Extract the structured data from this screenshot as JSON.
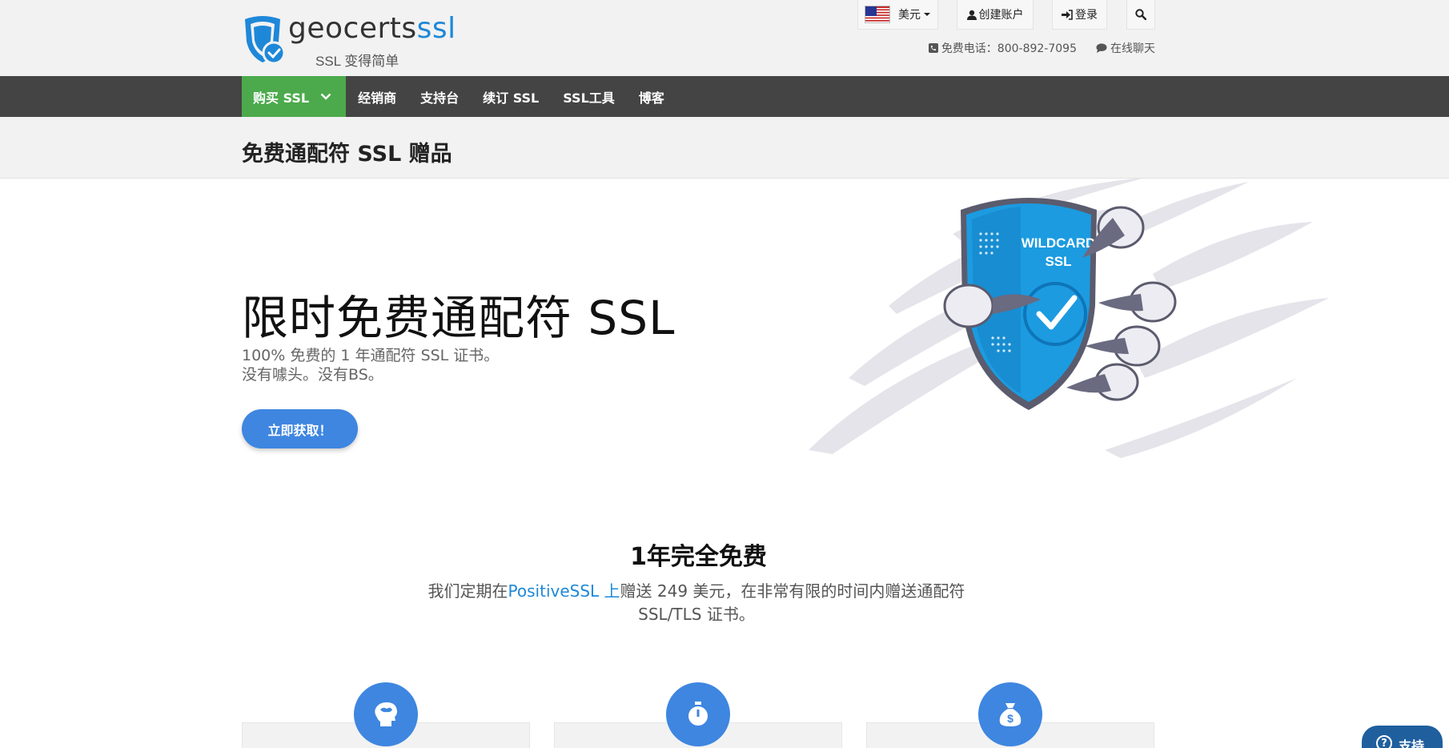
{
  "brand": {
    "name_main": "geocerts",
    "name_accent": "ssl",
    "tagline": "SSL 变得简单"
  },
  "utility": {
    "currency_label": "美元",
    "create_account_label": "创建账户",
    "login_label": "登录",
    "phone_text": "免费电话：800-892-7095",
    "chat_text": "在线聊天"
  },
  "nav": {
    "items": [
      {
        "label": "购买 SSL",
        "active": true
      },
      {
        "label": "经销商"
      },
      {
        "label": "支持台"
      },
      {
        "label": "续订 SSL"
      },
      {
        "label": "SSL工具"
      },
      {
        "label": "博客"
      }
    ]
  },
  "page": {
    "title": "免费通配符 SSL 赠品"
  },
  "hero": {
    "heading": "限时免费通配符 SSL",
    "sub_line1": "100% 免费的 1 年通配符 SSL 证书。",
    "sub_line2": "没有噱头。没有BS。",
    "cta_label": "立即获取！",
    "badge_line1": "WILDCARD",
    "badge_line2": "SSL"
  },
  "free_section": {
    "title": "1年完全免费",
    "desc_before": "我们定期在",
    "desc_link": "PositiveSSL 上",
    "desc_after": "赠送 249 美元，在非常有限的时间内赠送通配符 SSL/TLS 证书。"
  },
  "features": [
    {
      "icon": "brain-head-icon"
    },
    {
      "icon": "stopwatch-icon"
    },
    {
      "icon": "money-bag-icon"
    }
  ],
  "support": {
    "label": "支持"
  },
  "colors": {
    "accent": "#3e86e0",
    "nav_bg": "#444444",
    "nav_active": "#4caa4c",
    "brand_blue": "#1e88d8"
  }
}
